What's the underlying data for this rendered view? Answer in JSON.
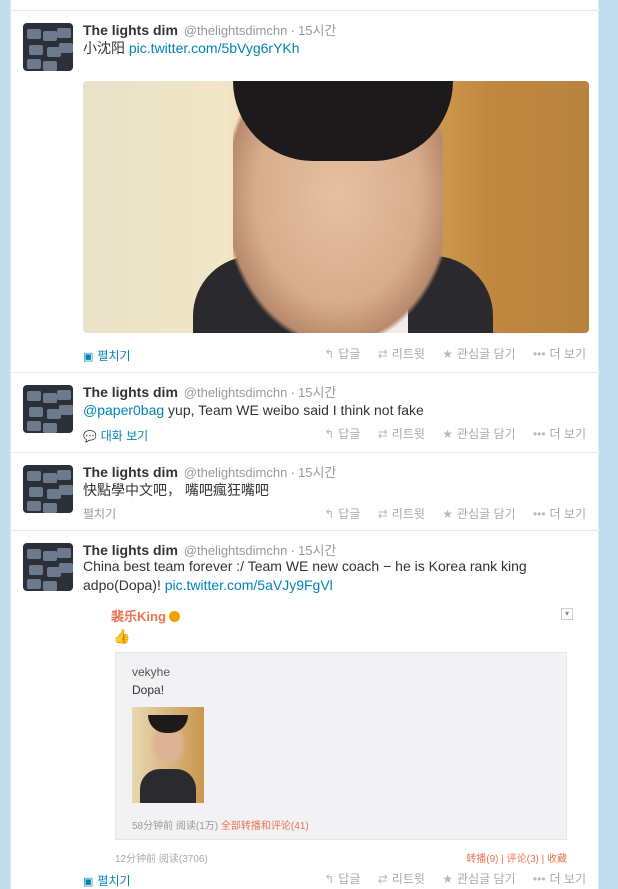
{
  "tweets": [
    {
      "name": "The lights dim",
      "handle": "@thelightsdimchn",
      "time": "15시간",
      "text": "小沈阳 ",
      "link": "pic.twitter.com/5bVyg6rYKh",
      "expand": "펼치기",
      "actions": [
        "답글",
        "리트윗",
        "관심글 담기",
        "더 보기"
      ]
    },
    {
      "name": "The lights dim",
      "handle": "@thelightsdimchn",
      "time": "15시간",
      "mention": "@paper0bag",
      "text": " yup, Team WE weibo said I think not fake",
      "expand": "대화 보기",
      "actions": [
        "답글",
        "리트윗",
        "관심글 담기",
        "더 보기"
      ]
    },
    {
      "name": "The lights dim",
      "handle": "@thelightsdimchn",
      "time": "15시간",
      "text": "快點學中文吧， 嘴吧瘋狂嘴吧",
      "expand": "펼치기",
      "actions": [
        "답글",
        "리트윗",
        "관심글 담기",
        "더 보기"
      ]
    },
    {
      "name": "The lights dim",
      "handle": "@thelightsdimchn",
      "time": "15시간",
      "text_line1": "China best team forever :/ Team WE new coach  −  he is Korea rank king",
      "text_line2": "adpo(Dopa)! ",
      "link": "pic.twitter.com/5aVJy9FgVl",
      "expand": "펼치기",
      "actions": [
        "답글",
        "리트윗",
        "관심글 담기",
        "더 보기"
      ]
    }
  ],
  "weibo": {
    "user": "裴乐King",
    "thumb": "👍",
    "orig_user": "vekyhe",
    "orig_text": "Dopa!",
    "meta_time": "58分钟前",
    "meta_reads": "阅读(1万)",
    "meta_link": "全部转播和评论(41)",
    "foot_time": "12分钟前",
    "foot_reads": "阅读(3706)",
    "foot_right": "转播(9)  |  评论(3)  |  收藏"
  },
  "colors": {
    "link": "#0084b4",
    "background": "#c0deed",
    "weibo_accent": "#eb7350"
  }
}
